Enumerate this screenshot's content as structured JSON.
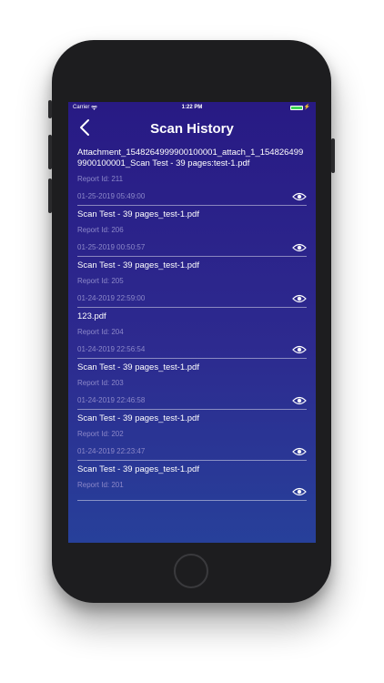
{
  "status_bar": {
    "carrier": "Carrier",
    "time": "1:22 PM",
    "battery_level": 1.0,
    "battery_color": "#40d659"
  },
  "nav": {
    "title": "Scan History",
    "back_icon": "chevron-left-icon"
  },
  "history": [
    {
      "name": "Attachment_1548264999900100001_attach_1_1548264999900100001_Scan Test - 39 pages:test-1.pdf",
      "report": "Report Id: 211",
      "date": "01-25-2019 05:49:00",
      "icon": "eye-icon"
    },
    {
      "name": "Scan Test - 39 pages_test-1.pdf",
      "report": "Report Id: 206",
      "date": "01-25-2019 00:50:57",
      "icon": "eye-icon"
    },
    {
      "name": "Scan Test - 39 pages_test-1.pdf",
      "report": "Report Id: 205",
      "date": "01-24-2019 22:59:00",
      "icon": "eye-icon"
    },
    {
      "name": "123.pdf",
      "report": "Report Id: 204",
      "date": "01-24-2019 22:56:54",
      "icon": "eye-icon"
    },
    {
      "name": "Scan Test - 39 pages_test-1.pdf",
      "report": "Report Id: 203",
      "date": "01-24-2019 22:46:58",
      "icon": "eye-icon"
    },
    {
      "name": "Scan Test - 39 pages_test-1.pdf",
      "report": "Report Id: 202",
      "date": "01-24-2019 22:23:47",
      "icon": "eye-icon"
    },
    {
      "name": "Scan Test - 39 pages_test-1.pdf",
      "report": "Report Id: 201",
      "date": "",
      "icon": "eye-icon"
    }
  ],
  "colors": {
    "background_top": "#281a84",
    "background_bottom": "#27409a",
    "secondary_text": "#8c88c9"
  }
}
